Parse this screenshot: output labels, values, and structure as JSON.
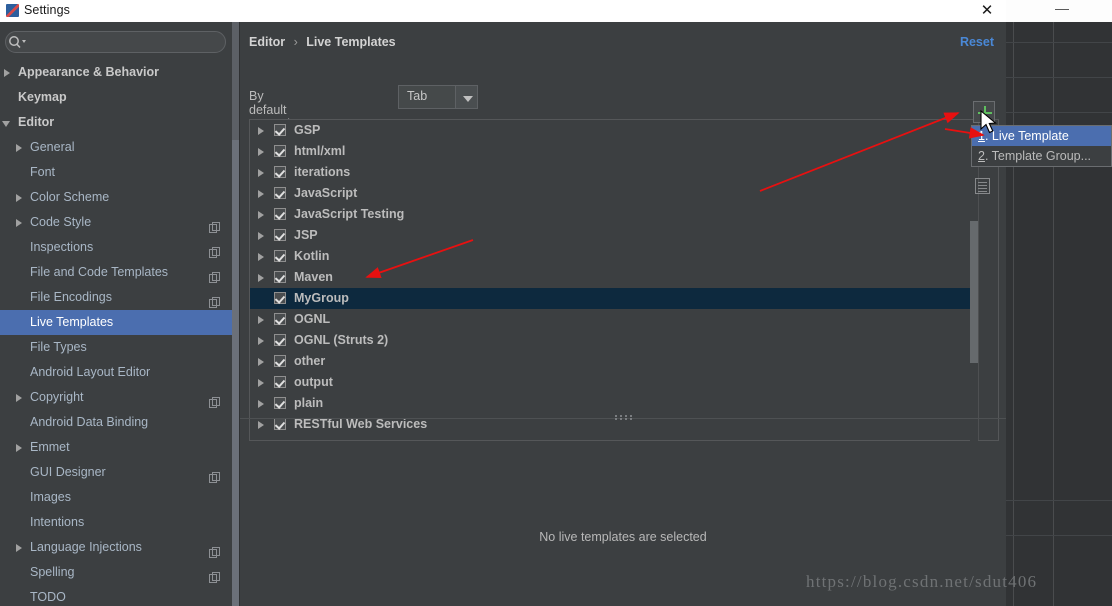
{
  "window": {
    "title": "Settings",
    "close_label": "✕",
    "app_icon": "idea-icon"
  },
  "search": {
    "value": "",
    "placeholder": ""
  },
  "sidebar": {
    "items": [
      {
        "label": "Appearance & Behavior",
        "level": 0,
        "twisty": "collapsed",
        "copy": false,
        "selected": false
      },
      {
        "label": "Keymap",
        "level": 0,
        "twisty": "none",
        "copy": false,
        "selected": false
      },
      {
        "label": "Editor",
        "level": 0,
        "twisty": "expanded",
        "copy": false,
        "selected": false
      },
      {
        "label": "General",
        "level": 1,
        "twisty": "collapsed",
        "copy": false,
        "selected": false
      },
      {
        "label": "Font",
        "level": 1,
        "twisty": "none",
        "copy": false,
        "selected": false
      },
      {
        "label": "Color Scheme",
        "level": 1,
        "twisty": "collapsed",
        "copy": false,
        "selected": false
      },
      {
        "label": "Code Style",
        "level": 1,
        "twisty": "collapsed",
        "copy": true,
        "selected": false
      },
      {
        "label": "Inspections",
        "level": 1,
        "twisty": "none",
        "copy": true,
        "selected": false
      },
      {
        "label": "File and Code Templates",
        "level": 1,
        "twisty": "none",
        "copy": true,
        "selected": false
      },
      {
        "label": "File Encodings",
        "level": 1,
        "twisty": "none",
        "copy": true,
        "selected": false
      },
      {
        "label": "Live Templates",
        "level": 1,
        "twisty": "none",
        "copy": false,
        "selected": true
      },
      {
        "label": "File Types",
        "level": 1,
        "twisty": "none",
        "copy": false,
        "selected": false
      },
      {
        "label": "Android Layout Editor",
        "level": 1,
        "twisty": "none",
        "copy": false,
        "selected": false
      },
      {
        "label": "Copyright",
        "level": 1,
        "twisty": "collapsed",
        "copy": true,
        "selected": false
      },
      {
        "label": "Android Data Binding",
        "level": 1,
        "twisty": "none",
        "copy": false,
        "selected": false
      },
      {
        "label": "Emmet",
        "level": 1,
        "twisty": "collapsed",
        "copy": false,
        "selected": false
      },
      {
        "label": "GUI Designer",
        "level": 1,
        "twisty": "none",
        "copy": true,
        "selected": false
      },
      {
        "label": "Images",
        "level": 1,
        "twisty": "none",
        "copy": false,
        "selected": false
      },
      {
        "label": "Intentions",
        "level": 1,
        "twisty": "none",
        "copy": false,
        "selected": false
      },
      {
        "label": "Language Injections",
        "level": 1,
        "twisty": "collapsed",
        "copy": true,
        "selected": false
      },
      {
        "label": "Spelling",
        "level": 1,
        "twisty": "none",
        "copy": true,
        "selected": false
      },
      {
        "label": "TODO",
        "level": 1,
        "twisty": "none",
        "copy": false,
        "selected": false
      }
    ]
  },
  "breadcrumb": {
    "parent": "Editor",
    "separator": "›",
    "current": "Live Templates"
  },
  "reset": {
    "label": "Reset"
  },
  "expand_with": {
    "label": "By default expand with",
    "value": "Tab"
  },
  "templates": {
    "groups": [
      {
        "name": "GSP",
        "checked": true,
        "expandable": true,
        "selected": false
      },
      {
        "name": "html/xml",
        "checked": true,
        "expandable": true,
        "selected": false
      },
      {
        "name": "iterations",
        "checked": true,
        "expandable": true,
        "selected": false
      },
      {
        "name": "JavaScript",
        "checked": true,
        "expandable": true,
        "selected": false
      },
      {
        "name": "JavaScript Testing",
        "checked": true,
        "expandable": true,
        "selected": false
      },
      {
        "name": "JSP",
        "checked": true,
        "expandable": true,
        "selected": false
      },
      {
        "name": "Kotlin",
        "checked": true,
        "expandable": true,
        "selected": false
      },
      {
        "name": "Maven",
        "checked": true,
        "expandable": true,
        "selected": false
      },
      {
        "name": "MyGroup",
        "checked": true,
        "expandable": false,
        "selected": true
      },
      {
        "name": "OGNL",
        "checked": true,
        "expandable": true,
        "selected": false
      },
      {
        "name": "OGNL (Struts 2)",
        "checked": true,
        "expandable": true,
        "selected": false
      },
      {
        "name": "other",
        "checked": true,
        "expandable": true,
        "selected": false
      },
      {
        "name": "output",
        "checked": true,
        "expandable": true,
        "selected": false
      },
      {
        "name": "plain",
        "checked": true,
        "expandable": true,
        "selected": false
      },
      {
        "name": "RESTful Web Services",
        "checked": true,
        "expandable": true,
        "selected": false
      }
    ]
  },
  "toolbar": {
    "add_label": "+",
    "add_icon": "plus-icon",
    "copy_icon": "document-icon"
  },
  "popup_menu": {
    "items": [
      {
        "mnemonic": "1",
        "label": ". Live Template",
        "highlighted": true
      },
      {
        "mnemonic": "2",
        "label": ". Template Group...",
        "highlighted": false
      }
    ]
  },
  "empty_state": {
    "message": "No live templates are selected"
  },
  "watermark": {
    "text": "https://blog.csdn.net/sdut406"
  },
  "colors": {
    "accent_blue": "#4b6eaf",
    "link_blue": "#4a88d6",
    "selection_navy": "#0d293e",
    "panel_bg": "#3c3f41",
    "plus_green": "#5fbf5f",
    "annotation_red": "#e81010"
  }
}
